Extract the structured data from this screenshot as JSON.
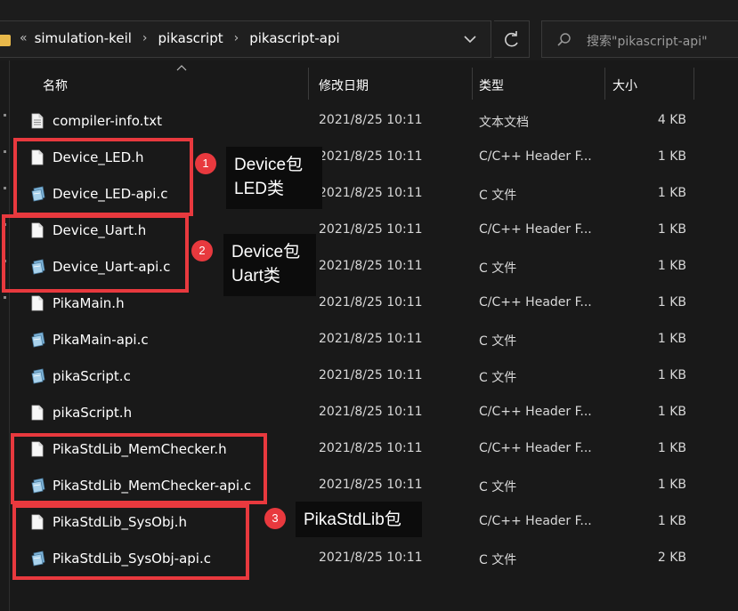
{
  "address_bar": {
    "overflow": "«",
    "breadcrumbs": [
      "simulation-keil",
      "pikascript",
      "pikascript-api"
    ],
    "separator": "›"
  },
  "search": {
    "placeholder": "搜索\"pikascript-api\""
  },
  "columns": {
    "name": "名称",
    "modified": "修改日期",
    "type": "类型",
    "size": "大小"
  },
  "files": [
    {
      "name": "compiler-info.txt",
      "date": "2021/8/25 10:11",
      "type": "文本文档",
      "size": "4 KB",
      "icon": "text-file-icon"
    },
    {
      "name": "Device_LED.h",
      "date": "2021/8/25 10:11",
      "type": "C/C++ Header F...",
      "size": "1 KB",
      "icon": "header-file-icon"
    },
    {
      "name": "Device_LED-api.c",
      "date": "2021/8/25 10:11",
      "type": "C 文件",
      "size": "1 KB",
      "icon": "c-file-icon"
    },
    {
      "name": "Device_Uart.h",
      "date": "2021/8/25 10:11",
      "type": "C/C++ Header F...",
      "size": "1 KB",
      "icon": "header-file-icon"
    },
    {
      "name": "Device_Uart-api.c",
      "date": "2021/8/25 10:11",
      "type": "C 文件",
      "size": "1 KB",
      "icon": "c-file-icon"
    },
    {
      "name": "PikaMain.h",
      "date": "2021/8/25 10:11",
      "type": "C/C++ Header F...",
      "size": "1 KB",
      "icon": "header-file-icon"
    },
    {
      "name": "PikaMain-api.c",
      "date": "2021/8/25 10:11",
      "type": "C 文件",
      "size": "1 KB",
      "icon": "c-file-icon"
    },
    {
      "name": "pikaScript.c",
      "date": "2021/8/25 10:11",
      "type": "C 文件",
      "size": "1 KB",
      "icon": "c-file-icon"
    },
    {
      "name": "pikaScript.h",
      "date": "2021/8/25 10:11",
      "type": "C/C++ Header F...",
      "size": "1 KB",
      "icon": "header-file-icon"
    },
    {
      "name": "PikaStdLib_MemChecker.h",
      "date": "2021/8/25 10:11",
      "type": "C/C++ Header F...",
      "size": "1 KB",
      "icon": "header-file-icon"
    },
    {
      "name": "PikaStdLib_MemChecker-api.c",
      "date": "2021/8/25 10:11",
      "type": "C 文件",
      "size": "1 KB",
      "icon": "c-file-icon"
    },
    {
      "name": "PikaStdLib_SysObj.h",
      "date": "2021/8/25 10:11",
      "type": "C/C++ Header F...",
      "size": "1 KB",
      "icon": "header-file-icon"
    },
    {
      "name": "PikaStdLib_SysObj-api.c",
      "date": "2021/8/25 10:11",
      "type": "C 文件",
      "size": "2 KB",
      "icon": "c-file-icon"
    }
  ],
  "annotations": [
    {
      "number": "1",
      "line1": "Device包",
      "line2": "LED类"
    },
    {
      "number": "2",
      "line1": "Device包",
      "line2": "Uart类"
    },
    {
      "number": "3",
      "line1": "PikaStdLib包",
      "line2": ""
    }
  ],
  "colors": {
    "annotation_red": "#e8393e",
    "background": "#191919",
    "folder": "#e8b84a"
  }
}
